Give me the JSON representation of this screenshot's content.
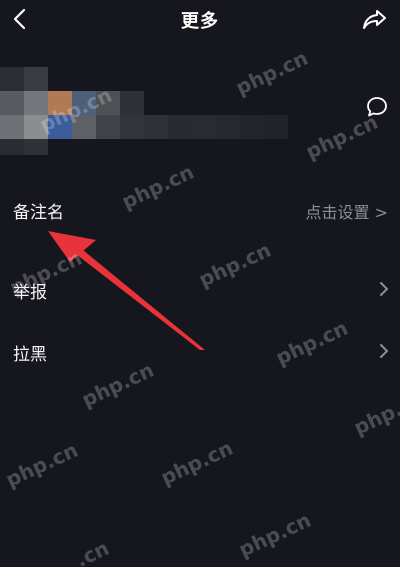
{
  "header": {
    "title": "更多",
    "back_icon": "chevron-left-icon",
    "share_icon": "share-arrow-icon"
  },
  "profile": {
    "chat_icon": "chat-bubble-icon"
  },
  "menu": {
    "items": [
      {
        "label": "备注名",
        "value": "点击设置 >"
      },
      {
        "label": "举报",
        "value": ""
      },
      {
        "label": "拉黑",
        "value": ""
      }
    ]
  },
  "watermark": {
    "text": "php.cn",
    "partial": ".cn"
  },
  "colors": {
    "background": "#16171e",
    "text": "#f5f5f5",
    "secondary_text": "#8d8e95",
    "annotation_arrow": "#e8333a"
  }
}
